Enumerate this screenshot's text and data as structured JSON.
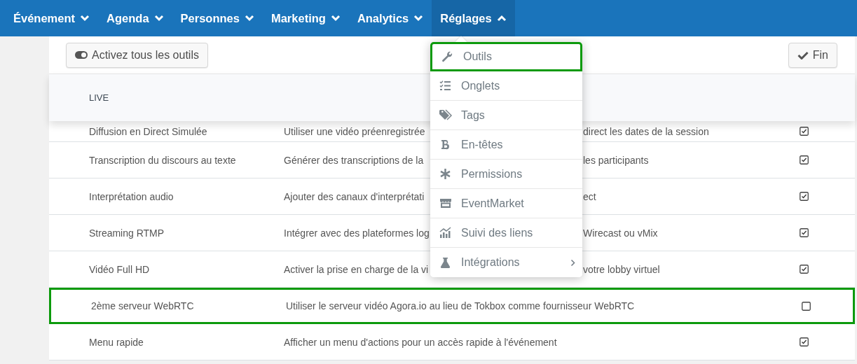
{
  "nav": {
    "items": [
      {
        "label": "Événement",
        "expanded": false
      },
      {
        "label": "Agenda",
        "expanded": false
      },
      {
        "label": "Personnes",
        "expanded": false
      },
      {
        "label": "Marketing",
        "expanded": false
      },
      {
        "label": "Analytics",
        "expanded": false
      },
      {
        "label": "Réglages",
        "expanded": true
      }
    ]
  },
  "toolbar": {
    "toggle_all_button": "Activez tous les outils",
    "done_button": "Fin"
  },
  "table": {
    "section_header": "LIVE",
    "rows": [
      {
        "name": "Diffusion en Direct Simulée",
        "description_start": "Utiliser une vidéo préenregistrée",
        "description_end": "direct les dates de la session",
        "checked": true,
        "highlighted": false
      },
      {
        "name": "Transcription du discours au texte",
        "description_start": "Générer des transcriptions de la",
        "description_end": "les participants",
        "checked": true,
        "highlighted": false
      },
      {
        "name": "Interprétation audio",
        "description_start": "Ajouter des canaux d'interprétati",
        "description_end": "ect",
        "checked": true,
        "highlighted": false
      },
      {
        "name": "Streaming RTMP",
        "description_start": "Intégrer avec des plateformes log",
        "description_end": "Wirecast ou vMix",
        "checked": true,
        "highlighted": false
      },
      {
        "name": "Vidéo Full HD",
        "description_start": "Activer la prise en charge de la vi",
        "description_end": "votre lobby virtuel",
        "checked": true,
        "highlighted": false
      },
      {
        "name": "2ème serveur WebRTC",
        "description_start": "Utiliser le serveur vidéo Agora.io au lieu de Tokbox comme fournisseur WebRTC",
        "checked": false,
        "highlighted": true
      },
      {
        "name": "Menu rapide",
        "description_start": "Afficher un menu d'actions pour un accès rapide à l'événement",
        "checked": true,
        "highlighted": false
      }
    ]
  },
  "settings_menu": {
    "items": [
      {
        "label": "Outils",
        "highlighted": true,
        "has_submenu": false
      },
      {
        "label": "Onglets",
        "highlighted": false,
        "has_submenu": false
      },
      {
        "label": "Tags",
        "highlighted": false,
        "has_submenu": false
      },
      {
        "label": "En-têtes",
        "highlighted": false,
        "has_submenu": false
      },
      {
        "label": "Permissions",
        "highlighted": false,
        "has_submenu": false
      },
      {
        "label": "EventMarket",
        "highlighted": false,
        "has_submenu": false
      },
      {
        "label": "Suivi des liens",
        "highlighted": false,
        "has_submenu": false
      },
      {
        "label": "Intégrations",
        "highlighted": false,
        "has_submenu": true
      }
    ]
  }
}
